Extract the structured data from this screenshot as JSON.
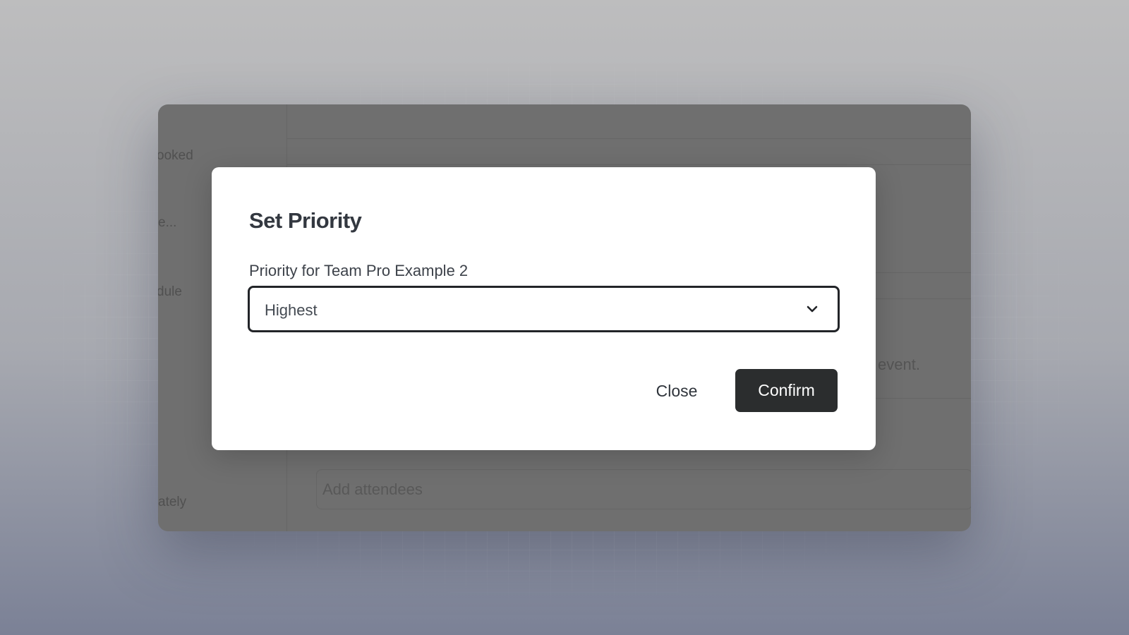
{
  "background": {
    "sidebar_fragments": [
      "ooked",
      "e...",
      "dule",
      "ately"
    ],
    "attendees_placeholder": "Add attendees",
    "event_fragment": "event."
  },
  "modal": {
    "title": "Set Priority",
    "field_label": "Priority for Team Pro Example 2",
    "select": {
      "selected_value": "Highest",
      "icon": "chevron-down-icon"
    },
    "close_label": "Close",
    "confirm_label": "Confirm"
  },
  "colors": {
    "confirm_button_bg": "#2b2d2e",
    "overlay": "#6f6f6f",
    "modal_bg": "#ffffff"
  }
}
